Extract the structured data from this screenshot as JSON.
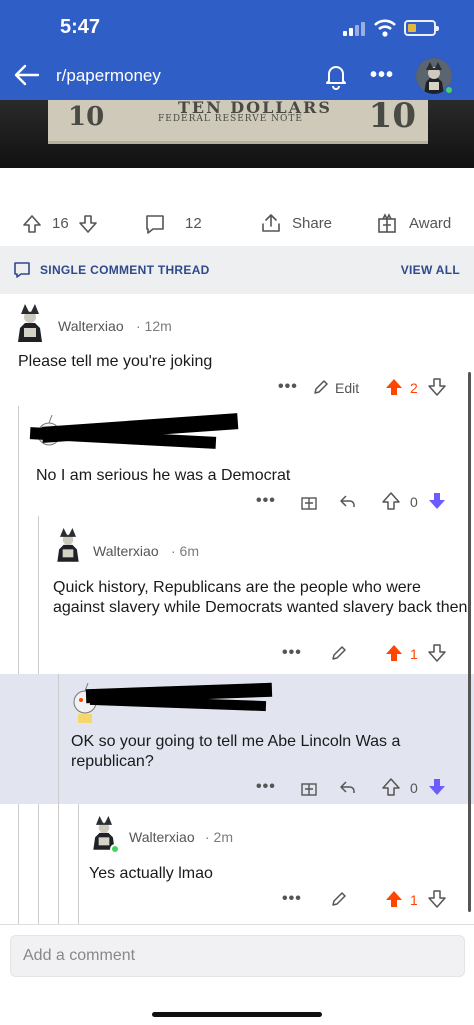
{
  "status_bar": {
    "time": "5:47"
  },
  "header": {
    "subreddit": "r/papermoney"
  },
  "note": {
    "line1": "TEN DOLLARS",
    "line2": "FEDERAL RESERVE NOTE",
    "denomination": "10"
  },
  "post_actions": {
    "upvotes": "16",
    "comments": "12",
    "share": "Share",
    "award": "Award"
  },
  "thread_bar": {
    "label": "SINGLE COMMENT THREAD",
    "view_all": "VIEW ALL"
  },
  "comments": [
    {
      "author": "Walterxiao",
      "age": "· 12m",
      "body": "Please tell me you're joking",
      "edit": "Edit",
      "score": "2"
    },
    {
      "author": "",
      "age": "",
      "body": "No I am serious he was a Democrat",
      "score": "0"
    },
    {
      "author": "Walterxiao",
      "age": "· 6m",
      "body": "Quick history, Republicans are the people who were against slavery while Democrats wanted slavery back then",
      "score": "1"
    },
    {
      "author": "",
      "age": "",
      "body": "OK so your going to tell me Abe Lincoln Was a republican?",
      "score": "0"
    },
    {
      "author": "Walterxiao",
      "age": "· 2m",
      "body": "Yes actually lmao",
      "score": "1"
    }
  ],
  "composer": {
    "placeholder": "Add a comment"
  },
  "colors": {
    "header": "#2f5fc6",
    "upvote": "#ff4500",
    "downvote": "#6a5cff",
    "highlight": "#e2e5ef"
  }
}
